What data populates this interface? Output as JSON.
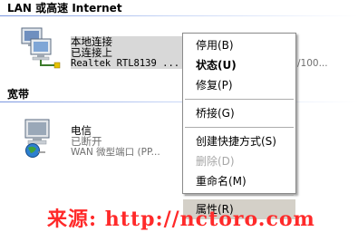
{
  "sections": {
    "lan_header": "LAN 或高速 Internet",
    "broadband_header": "宽带"
  },
  "connections": {
    "local": {
      "name": "本地连接",
      "status": "已连接上",
      "device": "Realtek RTL8139 ...",
      "device_tail": "/100..."
    },
    "telecom": {
      "name": "电信",
      "status": "已断开",
      "device": "WAN 微型端口 (PP...",
      "device_tail": "(PP..."
    }
  },
  "context_menu": {
    "items": [
      {
        "label": "停用(B)",
        "bold": false,
        "disabled": false
      },
      {
        "label": "状态(U)",
        "bold": true,
        "disabled": false
      },
      {
        "label": "修复(P)",
        "bold": false,
        "disabled": false
      },
      {
        "label": "桥接(G)",
        "bold": false,
        "disabled": false
      },
      {
        "label": "创建快捷方式(S)",
        "bold": false,
        "disabled": false
      },
      {
        "label": "删除(D)",
        "bold": false,
        "disabled": true
      },
      {
        "label": "重命名(M)",
        "bold": false,
        "disabled": false
      },
      {
        "label": "属性(R)",
        "bold": false,
        "disabled": false,
        "hovered": true
      }
    ]
  },
  "watermark": "来源: http://nctoro.com",
  "icons": {
    "local": "network-connection-icon",
    "telecom": "dialup-connection-icon"
  }
}
